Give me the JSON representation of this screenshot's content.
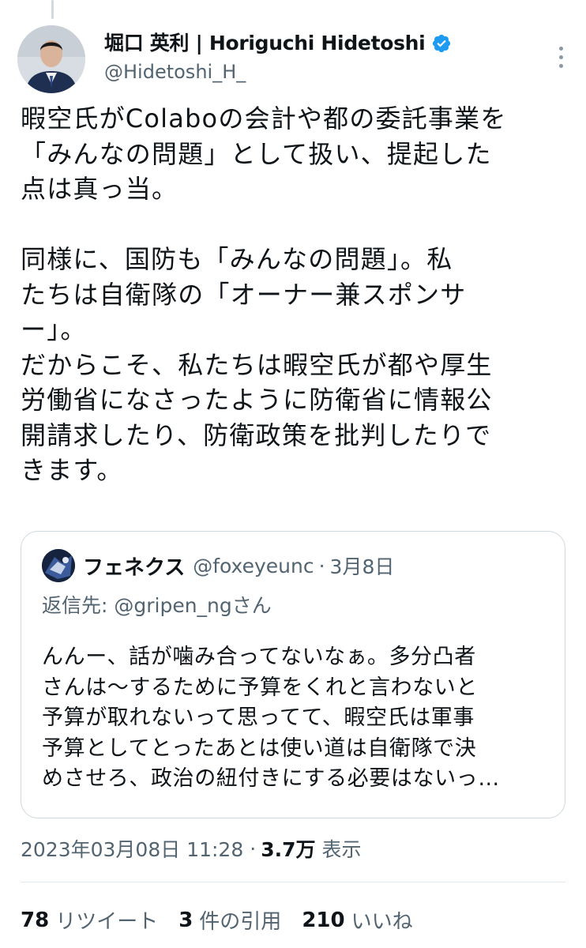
{
  "author": {
    "display_name": "堀口 英利 | Horiguchi Hidetoshi",
    "handle": "@Hidetoshi_H_",
    "verified": true,
    "verified_color": "#1d9bf0"
  },
  "tweet": {
    "text": "暇空氏がColaboの会計や都の委託事業を\n「みんなの問題」として扱い、提起した\n点は真っ当。\n\n同様に、国防も「みんなの問題」。私\nたちは自衛隊の「オーナー兼スポンサ\nー」。\nだからこそ、私たちは暇空氏が都や厚生\n労働省になさったように防衛省に情報公\n開請求したり、防衛政策を批判したりで\nきます。"
  },
  "quoted_tweet": {
    "display_name": "フェネクス",
    "handle": "@foxeyeunc",
    "separator": "·",
    "date": "3月8日",
    "reply_to": "返信先: @gripen_ngさん",
    "text": "んんー、話が噛み合ってないなぁ。多分凸者\nさんは〜するために予算をくれと言わないと\n予算が取れないって思ってて、暇空氏は軍事\n予算としてとったあとは使い道は自衛隊で決\nめさせろ、政治の紐付きにする必要はないっ…"
  },
  "meta": {
    "timestamp": "2023年03月08日 11:28",
    "separator": "·",
    "views_count": "3.7万",
    "views_label": "表示"
  },
  "stats": {
    "retweets_count": "78",
    "retweets_label": "リツイート",
    "quotes_count": "3",
    "quotes_label": "件の引用",
    "likes_count": "210",
    "likes_label": "いいね"
  },
  "icons": {
    "more": "more-icon",
    "verified": "verified-badge-icon"
  },
  "colors": {
    "secondary_text": "#536471",
    "border": "#cfd9de",
    "primary_text": "#0f1419"
  }
}
